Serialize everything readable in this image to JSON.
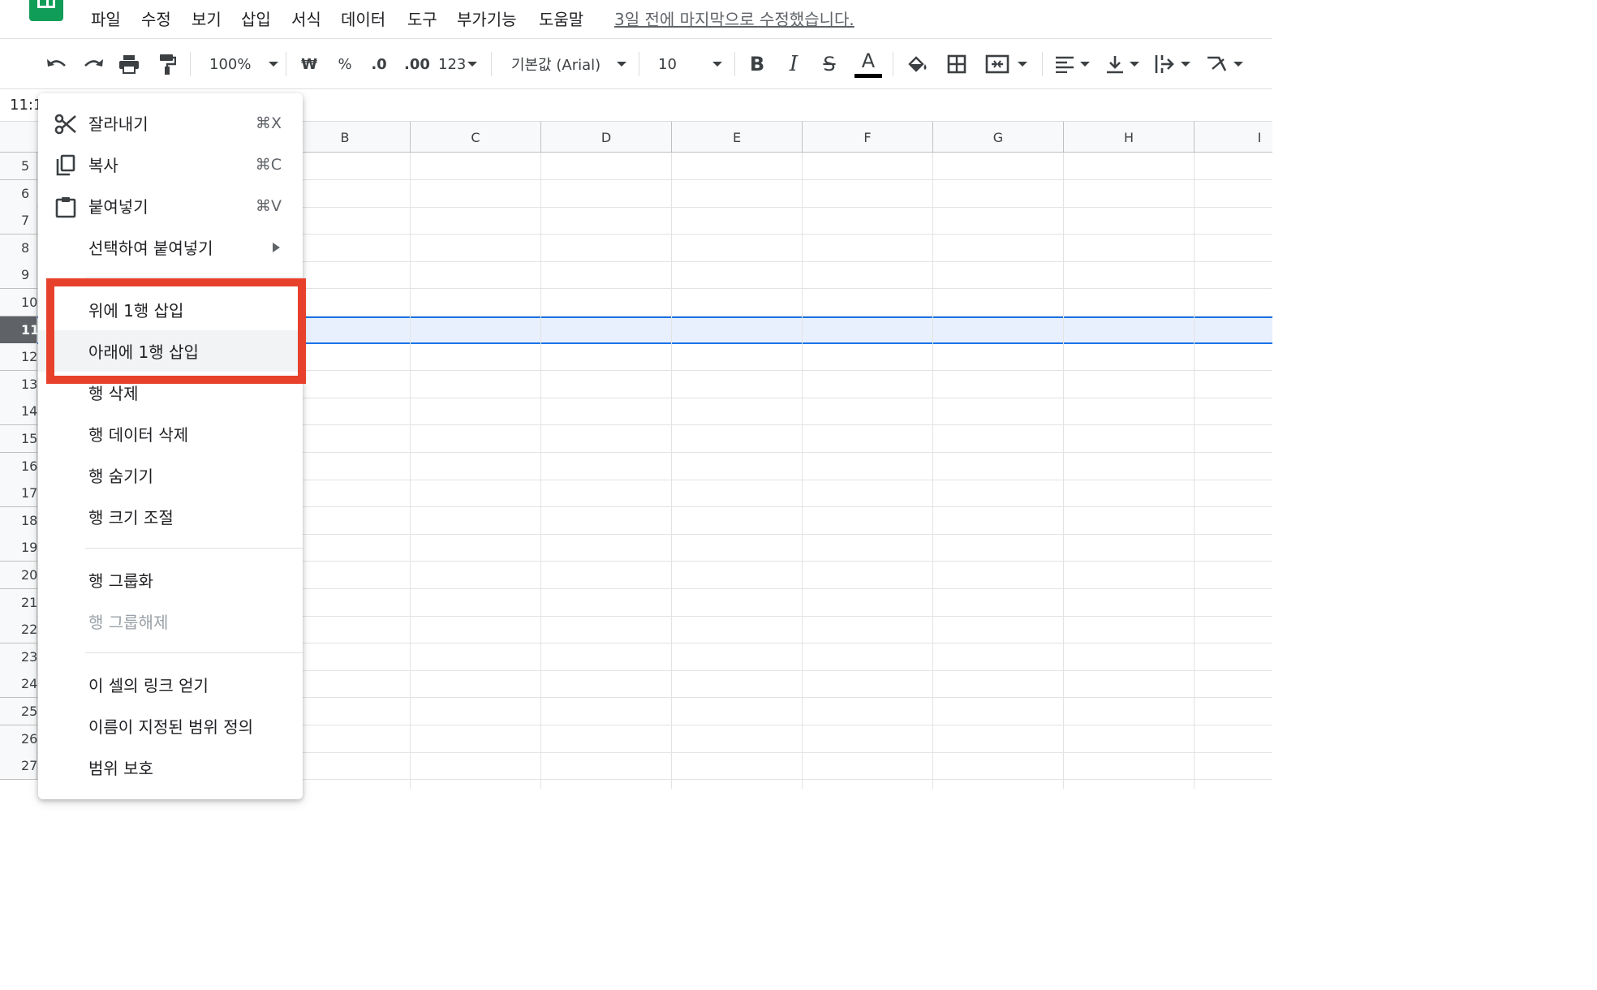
{
  "menubar": {
    "items": [
      "파일",
      "수정",
      "보기",
      "삽입",
      "서식",
      "데이터",
      "도구",
      "부가기능",
      "도움말"
    ],
    "last_edit": "3일 전에 마지막으로 수정했습니다."
  },
  "toolbar": {
    "zoom": "100%",
    "currency": "₩",
    "percent": "%",
    "decimal_decrease": ".0",
    "decimal_increase": ".00",
    "number_format": "123",
    "font": "기본값 (Arial)",
    "font_size": "10",
    "bold": "B",
    "italic": "I",
    "strike": "S",
    "text_color": "A"
  },
  "formula_bar": {
    "cell_ref": "11:1"
  },
  "columns": [
    "B",
    "C",
    "D",
    "E",
    "F",
    "G",
    "H",
    "I"
  ],
  "rows": [
    "5",
    "6",
    "7",
    "8",
    "9",
    "10",
    "11",
    "12",
    "13",
    "14",
    "15",
    "16",
    "17",
    "18",
    "19",
    "20",
    "21",
    "22",
    "23",
    "24",
    "25",
    "26",
    "27"
  ],
  "selected_row": "11",
  "context_menu": {
    "cut": {
      "label": "잘라내기",
      "shortcut": "⌘X"
    },
    "copy": {
      "label": "복사",
      "shortcut": "⌘C"
    },
    "paste": {
      "label": "붙여넣기",
      "shortcut": "⌘V"
    },
    "paste_special": {
      "label": "선택하여 붙여넣기"
    },
    "insert_above": {
      "label": "위에 1행 삽입"
    },
    "insert_below": {
      "label": "아래에 1행 삽입"
    },
    "delete_row": {
      "label": "행 삭제"
    },
    "clear_row": {
      "label": "행 데이터 삭제"
    },
    "hide_row": {
      "label": "행 숨기기"
    },
    "resize_row": {
      "label": "행 크기 조절"
    },
    "group_row": {
      "label": "행 그룹화"
    },
    "ungroup_row": {
      "label": "행 그룹해제"
    },
    "get_link": {
      "label": "이 셀의 링크 얻기"
    },
    "named_range": {
      "label": "이름이 지정된 범위 정의"
    },
    "protect_range": {
      "label": "범위 보호"
    }
  },
  "colors": {
    "highlight": "#e8412b",
    "selection": "#1a73e8",
    "sheets_green": "#0f9d58"
  }
}
